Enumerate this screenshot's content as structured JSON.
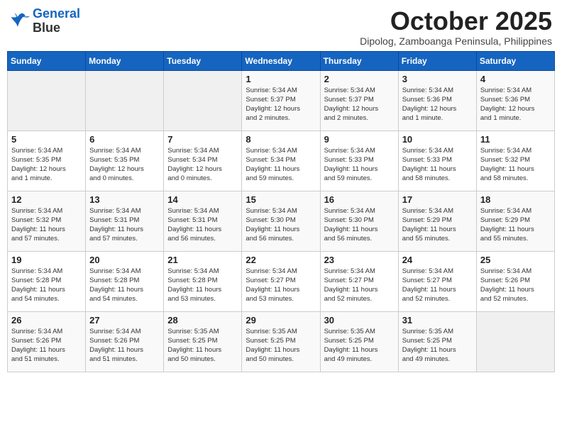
{
  "header": {
    "logo_line1": "General",
    "logo_line2": "Blue",
    "month": "October 2025",
    "location": "Dipolog, Zamboanga Peninsula, Philippines"
  },
  "weekdays": [
    "Sunday",
    "Monday",
    "Tuesday",
    "Wednesday",
    "Thursday",
    "Friday",
    "Saturday"
  ],
  "weeks": [
    [
      {
        "day": "",
        "info": ""
      },
      {
        "day": "",
        "info": ""
      },
      {
        "day": "",
        "info": ""
      },
      {
        "day": "1",
        "info": "Sunrise: 5:34 AM\nSunset: 5:37 PM\nDaylight: 12 hours\nand 2 minutes."
      },
      {
        "day": "2",
        "info": "Sunrise: 5:34 AM\nSunset: 5:37 PM\nDaylight: 12 hours\nand 2 minutes."
      },
      {
        "day": "3",
        "info": "Sunrise: 5:34 AM\nSunset: 5:36 PM\nDaylight: 12 hours\nand 1 minute."
      },
      {
        "day": "4",
        "info": "Sunrise: 5:34 AM\nSunset: 5:36 PM\nDaylight: 12 hours\nand 1 minute."
      }
    ],
    [
      {
        "day": "5",
        "info": "Sunrise: 5:34 AM\nSunset: 5:35 PM\nDaylight: 12 hours\nand 1 minute."
      },
      {
        "day": "6",
        "info": "Sunrise: 5:34 AM\nSunset: 5:35 PM\nDaylight: 12 hours\nand 0 minutes."
      },
      {
        "day": "7",
        "info": "Sunrise: 5:34 AM\nSunset: 5:34 PM\nDaylight: 12 hours\nand 0 minutes."
      },
      {
        "day": "8",
        "info": "Sunrise: 5:34 AM\nSunset: 5:34 PM\nDaylight: 11 hours\nand 59 minutes."
      },
      {
        "day": "9",
        "info": "Sunrise: 5:34 AM\nSunset: 5:33 PM\nDaylight: 11 hours\nand 59 minutes."
      },
      {
        "day": "10",
        "info": "Sunrise: 5:34 AM\nSunset: 5:33 PM\nDaylight: 11 hours\nand 58 minutes."
      },
      {
        "day": "11",
        "info": "Sunrise: 5:34 AM\nSunset: 5:32 PM\nDaylight: 11 hours\nand 58 minutes."
      }
    ],
    [
      {
        "day": "12",
        "info": "Sunrise: 5:34 AM\nSunset: 5:32 PM\nDaylight: 11 hours\nand 57 minutes."
      },
      {
        "day": "13",
        "info": "Sunrise: 5:34 AM\nSunset: 5:31 PM\nDaylight: 11 hours\nand 57 minutes."
      },
      {
        "day": "14",
        "info": "Sunrise: 5:34 AM\nSunset: 5:31 PM\nDaylight: 11 hours\nand 56 minutes."
      },
      {
        "day": "15",
        "info": "Sunrise: 5:34 AM\nSunset: 5:30 PM\nDaylight: 11 hours\nand 56 minutes."
      },
      {
        "day": "16",
        "info": "Sunrise: 5:34 AM\nSunset: 5:30 PM\nDaylight: 11 hours\nand 56 minutes."
      },
      {
        "day": "17",
        "info": "Sunrise: 5:34 AM\nSunset: 5:29 PM\nDaylight: 11 hours\nand 55 minutes."
      },
      {
        "day": "18",
        "info": "Sunrise: 5:34 AM\nSunset: 5:29 PM\nDaylight: 11 hours\nand 55 minutes."
      }
    ],
    [
      {
        "day": "19",
        "info": "Sunrise: 5:34 AM\nSunset: 5:28 PM\nDaylight: 11 hours\nand 54 minutes."
      },
      {
        "day": "20",
        "info": "Sunrise: 5:34 AM\nSunset: 5:28 PM\nDaylight: 11 hours\nand 54 minutes."
      },
      {
        "day": "21",
        "info": "Sunrise: 5:34 AM\nSunset: 5:28 PM\nDaylight: 11 hours\nand 53 minutes."
      },
      {
        "day": "22",
        "info": "Sunrise: 5:34 AM\nSunset: 5:27 PM\nDaylight: 11 hours\nand 53 minutes."
      },
      {
        "day": "23",
        "info": "Sunrise: 5:34 AM\nSunset: 5:27 PM\nDaylight: 11 hours\nand 52 minutes."
      },
      {
        "day": "24",
        "info": "Sunrise: 5:34 AM\nSunset: 5:27 PM\nDaylight: 11 hours\nand 52 minutes."
      },
      {
        "day": "25",
        "info": "Sunrise: 5:34 AM\nSunset: 5:26 PM\nDaylight: 11 hours\nand 52 minutes."
      }
    ],
    [
      {
        "day": "26",
        "info": "Sunrise: 5:34 AM\nSunset: 5:26 PM\nDaylight: 11 hours\nand 51 minutes."
      },
      {
        "day": "27",
        "info": "Sunrise: 5:34 AM\nSunset: 5:26 PM\nDaylight: 11 hours\nand 51 minutes."
      },
      {
        "day": "28",
        "info": "Sunrise: 5:35 AM\nSunset: 5:25 PM\nDaylight: 11 hours\nand 50 minutes."
      },
      {
        "day": "29",
        "info": "Sunrise: 5:35 AM\nSunset: 5:25 PM\nDaylight: 11 hours\nand 50 minutes."
      },
      {
        "day": "30",
        "info": "Sunrise: 5:35 AM\nSunset: 5:25 PM\nDaylight: 11 hours\nand 49 minutes."
      },
      {
        "day": "31",
        "info": "Sunrise: 5:35 AM\nSunset: 5:25 PM\nDaylight: 11 hours\nand 49 minutes."
      },
      {
        "day": "",
        "info": ""
      }
    ]
  ]
}
